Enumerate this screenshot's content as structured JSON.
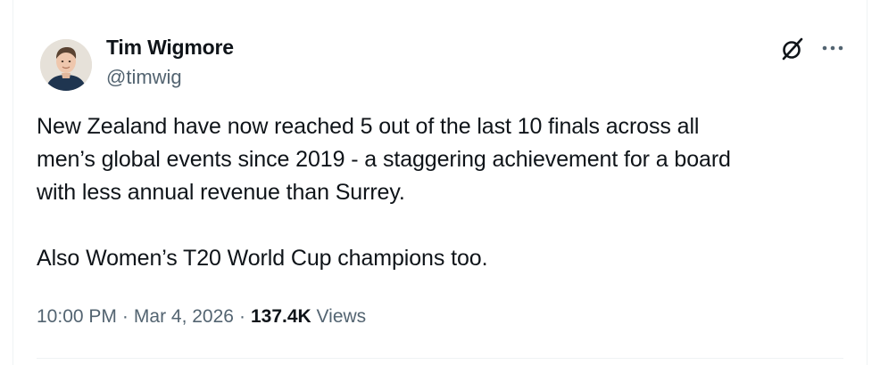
{
  "author": {
    "name": "Tim Wigmore",
    "handle": "@timwig"
  },
  "tweet": {
    "paragraph1_line1": "New Zealand have now reached 5 out of the last 10 finals across all",
    "paragraph1_line2": "men’s global events since 2019 - a staggering achievement for a board",
    "paragraph1_line3": "with less annual revenue than Surrey.",
    "paragraph2": "Also Women’s T20 World Cup champions too."
  },
  "meta": {
    "time": "10:00 PM",
    "separator": "·",
    "date": "Mar 4, 2026",
    "views_count": "137.4K",
    "views_label": "Views"
  },
  "icons": {
    "grok": "grok-icon",
    "more": "more-icon"
  },
  "colors": {
    "text": "#0f1419",
    "secondary": "#536471",
    "border": "#eff3f4"
  }
}
